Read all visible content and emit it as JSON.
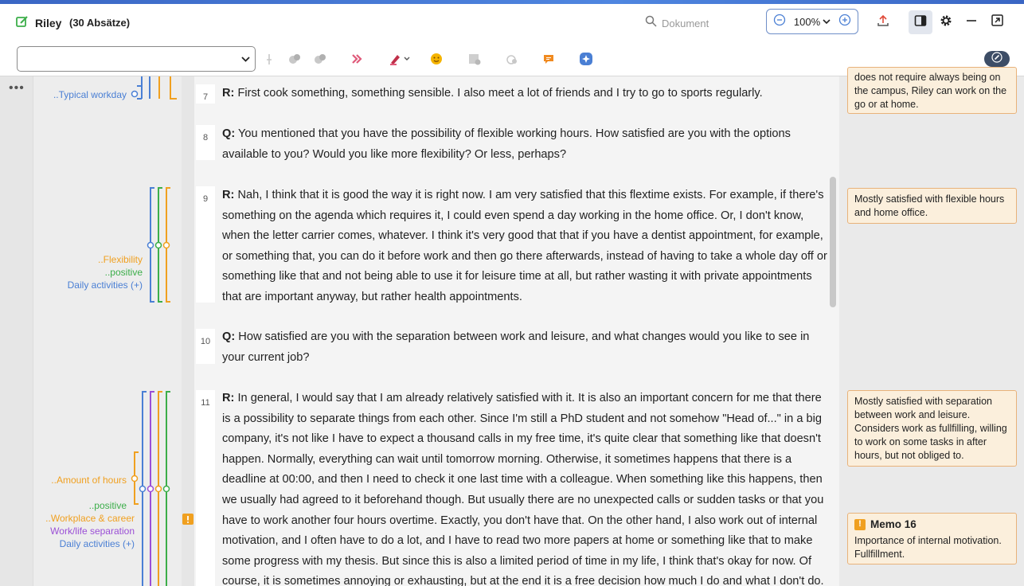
{
  "header": {
    "doc_name": "Riley",
    "doc_count": "(30 Absätze)",
    "search_placeholder": "Dokument",
    "zoom": "100%"
  },
  "icons": {
    "edit": "pencil-square-icon",
    "search": "magnifier-icon",
    "zoom_out": "minus-circle-icon",
    "zoom_in": "plus-circle-icon",
    "export": "upload-icon",
    "panel": "side-panel-icon",
    "settings": "gear-icon",
    "minimize": "minus-icon",
    "popout": "external-window-icon"
  },
  "colors": {
    "blue": "#4a7fd4",
    "green": "#3cae4a",
    "orange": "#f0a020",
    "purple": "#9b4fd6",
    "memo_bg": "#fbefdc",
    "memo_border": "#e8b27a"
  },
  "codes": {
    "typical_workday": "..Typical workday",
    "flexibility": "..Flexibility",
    "positive_1": "..positive",
    "daily_1": "Daily activities (+)",
    "amount_hours": "..Amount of hours",
    "positive_2": "..positive",
    "workplace": "..Workplace & career",
    "worklife": "Work/life separation",
    "daily_2": "Daily activities (+)"
  },
  "paragraphs": [
    {
      "num": "7",
      "speaker": "R",
      "text": "First cook something, something sensible. I also meet a lot of friends and I try to go to sports regularly."
    },
    {
      "num": "8",
      "speaker": "Q",
      "text": "You mentioned that you have the possibility of flexible working hours. How satisfied are you with the options available to you? Would you like more flexibility? Or less, perhaps?"
    },
    {
      "num": "9",
      "speaker": "R",
      "text": "Nah, I think that it is good the way it is right now. I am very satisfied that this flextime exists. For example, if there's something on the agenda which requires it, I could even spend a day working in the home office. Or, I don't know, when the letter carrier comes, whatever. I think it's very good that that if you have a dentist appointment, for example, or something that, you can do it before work and then go there afterwards, instead of having to take a whole day off or something like that and not being able to use it for leisure time at all, but rather wasting it with private appointments that are important anyway, but rather health appointments."
    },
    {
      "num": "10",
      "speaker": "Q",
      "text": "How satisfied are you with the separation between work and leisure, and what changes would you like to see in your current job?"
    },
    {
      "num": "11",
      "speaker": "R",
      "text": "In general, I would say that I am already relatively satisfied with it. It is also an important concern for me that there is a possibility to separate things from each other. Since I'm still a PhD student and not somehow \"Head of...\" in a big company, it's not like I have to expect a thousand calls in my free time, it's quite clear that something like that doesn't happen. Normally, everything can wait until tomorrow morning. Otherwise, it sometimes happens that there is a deadline at 00:00, and then I need to check it one last time with a colleague. When something like this happens, then we usually had agreed to it beforehand though. But usually there are no unexpected calls or sudden tasks or that you have to work another four hours overtime. Exactly, you don't have that. On the other hand, I also work out of internal motivation, and I often have to do a lot, and I have to read two more papers at home or something like that to make some progress with my thesis. But since this is also a limited period of time in my life, I think that's okay for now. Of course, it is sometimes annoying or exhausting, but at the end it is a free decision how much I do and what I don't do."
    }
  ],
  "memos": [
    {
      "text": "does not require always being on the campus, Riley can work on the go or at home."
    },
    {
      "text": "Mostly satisfied with flexible hours and home office."
    },
    {
      "text": "Mostly satisfied with separation between work and leisure. Considers work as fullfilling, willing to work on some tasks in after hours, but not obliged to."
    },
    {
      "title": "Memo 16",
      "text": "Importance of internal motivation. Fullfillment."
    }
  ]
}
